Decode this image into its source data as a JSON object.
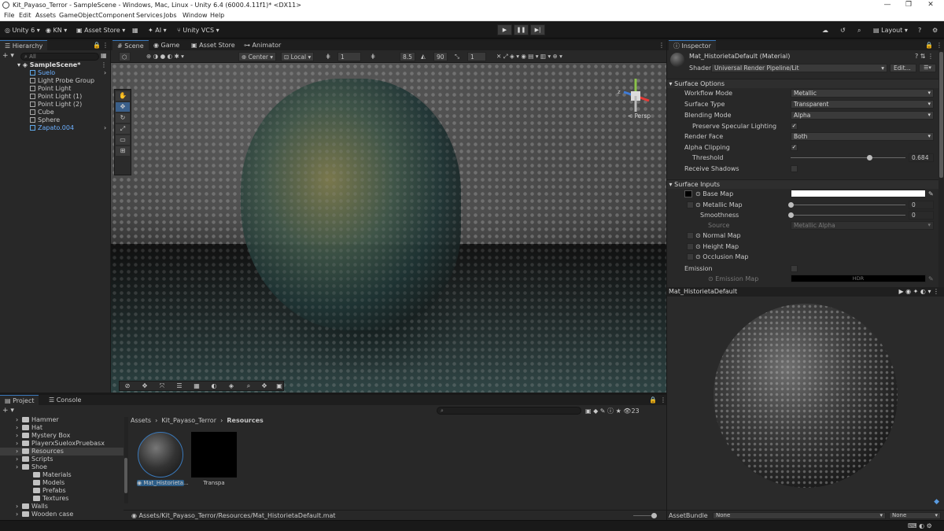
{
  "window": {
    "title": "Kit_Payaso_Terror - SampleScene - Windows, Mac, Linux - Unity 6.4 (6000.4.11f1)* <DX11>",
    "controls": [
      "—",
      "❐",
      "✕"
    ]
  },
  "menu": [
    "File",
    "Edit",
    "Assets",
    "GameObject",
    "Component",
    "Services",
    "Jobs",
    "Window",
    "Help"
  ],
  "toolbar": {
    "unity_label": "Unity 6",
    "account": "KN",
    "asset_store": "Asset Store",
    "ai": "AI",
    "vcs": "Unity VCS",
    "layout": "Layout"
  },
  "hierarchy": {
    "tab": "Hierarchy",
    "search_placeholder": "All",
    "scene_name": "SampleScene*",
    "items": [
      {
        "label": "Suelo",
        "highlight": true
      },
      {
        "label": "Light Probe Group",
        "highlight": false
      },
      {
        "label": "Point Light",
        "highlight": false
      },
      {
        "label": "Point Light (1)",
        "highlight": false
      },
      {
        "label": "Point Light (2)",
        "highlight": false
      },
      {
        "label": "Cube",
        "highlight": false
      },
      {
        "label": "Sphere",
        "highlight": false
      },
      {
        "label": "Zapato.004",
        "highlight": true
      }
    ]
  },
  "scene": {
    "tabs": [
      "Scene",
      "Game",
      "Asset Store",
      "Animator"
    ],
    "pivot": "Center",
    "space": "Local",
    "grid_value": "1",
    "snap_value": "8.5",
    "angle_value": "90",
    "scale_value": "1",
    "persp_label": "< Persp"
  },
  "inspector": {
    "tab": "Inspector",
    "material_name": "Mat_HistorietaDefault (Material)",
    "shader_label": "Shader",
    "shader_value": "Universal Render Pipeline/Lit",
    "edit_button": "Edit...",
    "surface_options": "Surface Options",
    "workflow_mode": {
      "label": "Workflow Mode",
      "value": "Metallic"
    },
    "surface_type": {
      "label": "Surface Type",
      "value": "Transparent"
    },
    "blending_mode": {
      "label": "Blending Mode",
      "value": "Alpha"
    },
    "preserve_specular": {
      "label": "Preserve Specular Lighting",
      "checked": true
    },
    "render_face": {
      "label": "Render Face",
      "value": "Both"
    },
    "alpha_clipping": {
      "label": "Alpha Clipping",
      "checked": true
    },
    "threshold": {
      "label": "Threshold",
      "value": "0.684",
      "fraction": 0.684
    },
    "receive_shadows": {
      "label": "Receive Shadows",
      "checked": false
    },
    "surface_inputs": "Surface Inputs",
    "base_map": {
      "label": "Base Map",
      "color": "#ffffff"
    },
    "metallic_map": {
      "label": "Metallic Map",
      "value": "0",
      "fraction": 0
    },
    "smoothness": {
      "label": "Smoothness",
      "value": "0",
      "fraction": 0
    },
    "source": {
      "label": "Source",
      "value": "Metallic Alpha"
    },
    "normal_map": "Normal Map",
    "height_map": "Height Map",
    "occlusion_map": "Occlusion Map",
    "emission": {
      "label": "Emission",
      "checked": false
    },
    "emission_map": {
      "label": "Emission Map",
      "value": "HDR"
    }
  },
  "preview": {
    "title": "Mat_HistorietaDefault",
    "assetbundle_label": "AssetBundle",
    "assetbundle_value": "None",
    "variant_value": "None"
  },
  "project": {
    "tabs": [
      "Project",
      "Console"
    ],
    "count": "23",
    "folders": [
      {
        "label": "Hammer",
        "indent": 1,
        "selected": false
      },
      {
        "label": "Hat",
        "indent": 1,
        "selected": false
      },
      {
        "label": "Mystery Box",
        "indent": 1,
        "selected": false
      },
      {
        "label": "PlayerxSueloxPruebasx",
        "indent": 1,
        "selected": false
      },
      {
        "label": "Resources",
        "indent": 1,
        "selected": true
      },
      {
        "label": "Scripts",
        "indent": 1,
        "selected": false
      },
      {
        "label": "Shoe",
        "indent": 1,
        "selected": false
      },
      {
        "label": "Materials",
        "indent": 2,
        "selected": false
      },
      {
        "label": "Models",
        "indent": 2,
        "selected": false
      },
      {
        "label": "Prefabs",
        "indent": 2,
        "selected": false
      },
      {
        "label": "Textures",
        "indent": 2,
        "selected": false
      },
      {
        "label": "Walls",
        "indent": 1,
        "selected": false
      },
      {
        "label": "Wooden case",
        "indent": 1,
        "selected": false
      }
    ],
    "breadcrumb": [
      "Assets",
      "Kit_Payaso_Terror",
      "Resources"
    ],
    "assets": [
      {
        "label": "Mat_Historieta...",
        "selected": true
      },
      {
        "label": "Transpa",
        "selected": false
      }
    ],
    "path": "Assets/Kit_Payaso_Terror/Resources/Mat_HistorietaDefault.mat"
  }
}
